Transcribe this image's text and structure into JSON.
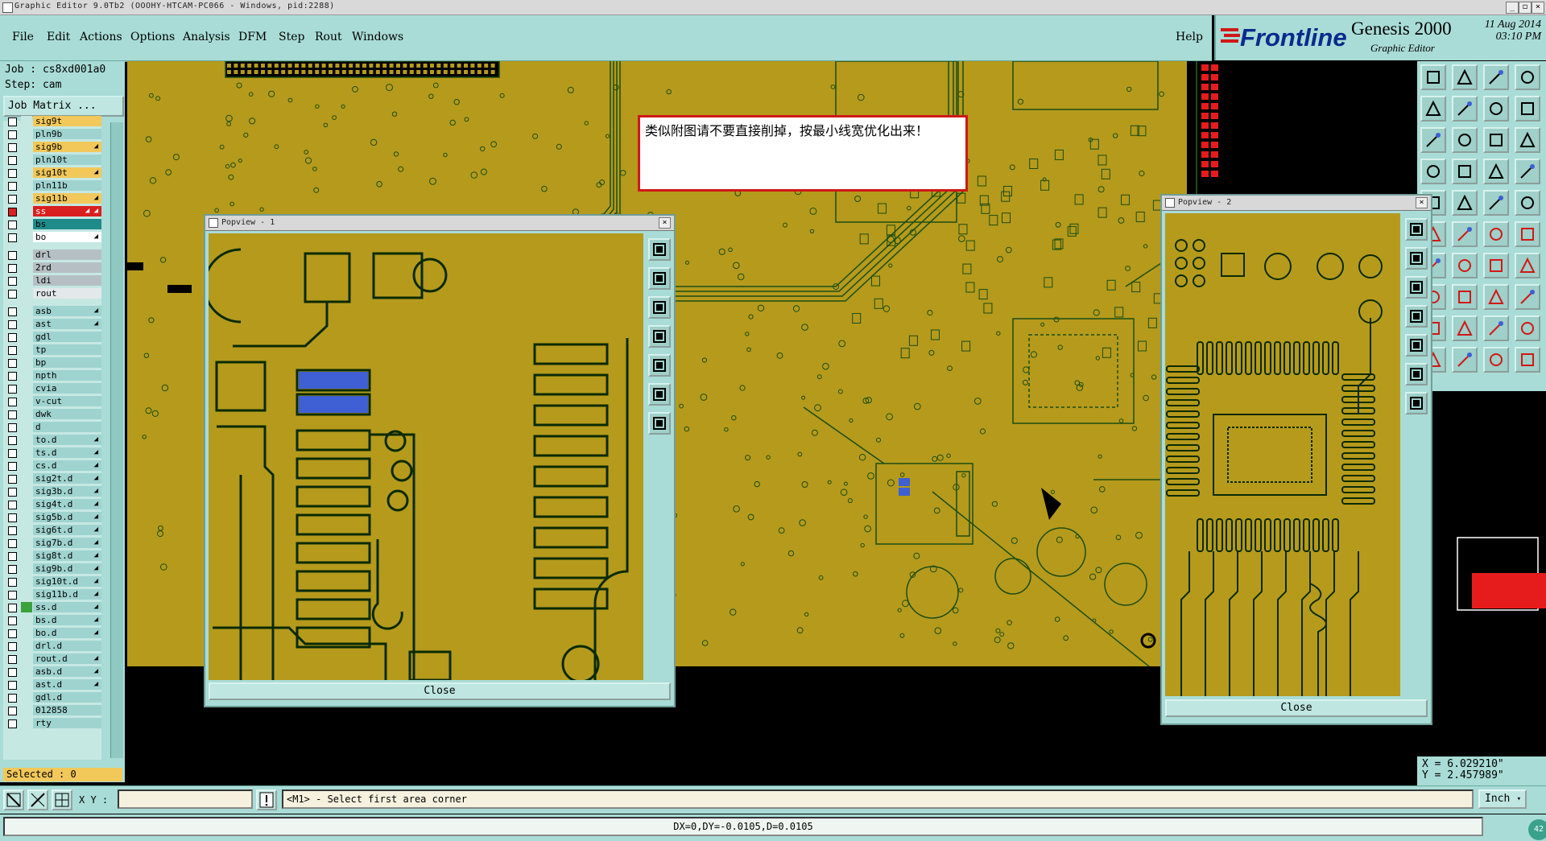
{
  "window": {
    "title": "Graphic Editor 9.0Tb2 (OOOHY-HTCAM-PC066 - Windows, pid:2288)"
  },
  "menu": {
    "items": [
      "File",
      "Edit",
      "Actions",
      "Options",
      "Analysis",
      "DFM",
      "Step",
      "Rout",
      "Windows"
    ],
    "help": "Help"
  },
  "logo": {
    "brand": "Frontline",
    "product": "Genesis 2000",
    "subtitle": "Graphic Editor",
    "date": "11 Aug 2014",
    "time": "03:10 PM"
  },
  "job": {
    "job_line": "Job : cs8xd001a0",
    "step_line": "Step: cam",
    "matrix_button": "Job Matrix ..."
  },
  "layers": [
    {
      "name": "sig9t",
      "color": "#f2c85a",
      "arrow": "",
      "checked": false
    },
    {
      "name": "pln9b",
      "color": "#9fd3cf",
      "arrow": "",
      "checked": false
    },
    {
      "name": "sig9b",
      "color": "#f2c85a",
      "arrow": "◢",
      "checked": false
    },
    {
      "name": "pln10t",
      "color": "#9fd3cf",
      "arrow": "",
      "checked": false
    },
    {
      "name": "sig10t",
      "color": "#f2c85a",
      "arrow": "◢",
      "checked": false
    },
    {
      "name": "pln11b",
      "color": "#9fd3cf",
      "arrow": "",
      "checked": false
    },
    {
      "name": "sig11b",
      "color": "#f2c85a",
      "arrow": "◢",
      "checked": false
    },
    {
      "name": "ss",
      "color": "#d92020",
      "arrow": "◢ ◢",
      "checked": true
    },
    {
      "name": "bs",
      "color": "#1f8a8a",
      "arrow": "",
      "checked": false
    },
    {
      "name": "bo",
      "color": "#ffffff",
      "arrow": "◢",
      "checked": false
    },
    {
      "name": "drl",
      "color": "#b6c0c4",
      "arrow": "",
      "checked": false
    },
    {
      "name": "2rd",
      "color": "#b6c0c4",
      "arrow": "",
      "checked": false
    },
    {
      "name": "ldi",
      "color": "#b6c0c4",
      "arrow": "",
      "checked": false
    },
    {
      "name": "rout",
      "color": "#e3e8ea",
      "arrow": "",
      "checked": false
    },
    {
      "name": "asb",
      "color": "#9fd3cf",
      "arrow": "◢",
      "checked": false
    },
    {
      "name": "ast",
      "color": "#9fd3cf",
      "arrow": "◢",
      "checked": false
    },
    {
      "name": "gdl",
      "color": "#9fd3cf",
      "arrow": "",
      "checked": false
    },
    {
      "name": "tp",
      "color": "#9fd3cf",
      "arrow": "",
      "checked": false
    },
    {
      "name": "bp",
      "color": "#9fd3cf",
      "arrow": "",
      "checked": false
    },
    {
      "name": "npth",
      "color": "#9fd3cf",
      "arrow": "",
      "checked": false
    },
    {
      "name": "cvia",
      "color": "#9fd3cf",
      "arrow": "",
      "checked": false
    },
    {
      "name": "v-cut",
      "color": "#9fd3cf",
      "arrow": "",
      "checked": false
    },
    {
      "name": "dwk",
      "color": "#9fd3cf",
      "arrow": "",
      "checked": false
    },
    {
      "name": "d",
      "color": "#9fd3cf",
      "arrow": "",
      "checked": false
    },
    {
      "name": "to.d",
      "color": "#9fd3cf",
      "arrow": "◢",
      "checked": false
    },
    {
      "name": "ts.d",
      "color": "#9fd3cf",
      "arrow": "◢",
      "checked": false
    },
    {
      "name": "cs.d",
      "color": "#9fd3cf",
      "arrow": "◢",
      "checked": false
    },
    {
      "name": "sig2t.d",
      "color": "#9fd3cf",
      "arrow": "◢",
      "checked": false
    },
    {
      "name": "sig3b.d",
      "color": "#9fd3cf",
      "arrow": "◢",
      "checked": false
    },
    {
      "name": "sig4t.d",
      "color": "#9fd3cf",
      "arrow": "◢",
      "checked": false
    },
    {
      "name": "sig5b.d",
      "color": "#9fd3cf",
      "arrow": "◢",
      "checked": false
    },
    {
      "name": "sig6t.d",
      "color": "#9fd3cf",
      "arrow": "◢",
      "checked": false
    },
    {
      "name": "sig7b.d",
      "color": "#9fd3cf",
      "arrow": "◢",
      "checked": false
    },
    {
      "name": "sig8t.d",
      "color": "#9fd3cf",
      "arrow": "◢",
      "checked": false
    },
    {
      "name": "sig9b.d",
      "color": "#9fd3cf",
      "arrow": "◢",
      "checked": false
    },
    {
      "name": "sig10t.d",
      "color": "#9fd3cf",
      "arrow": "◢",
      "checked": false
    },
    {
      "name": "sig11b.d",
      "color": "#9fd3cf",
      "arrow": "◢",
      "checked": false
    },
    {
      "name": "ss.d",
      "color": "#9fd3cf",
      "arrow": "◢",
      "checked": false
    },
    {
      "name": "bs.d",
      "color": "#9fd3cf",
      "arrow": "◢",
      "checked": false
    },
    {
      "name": "bo.d",
      "color": "#9fd3cf",
      "arrow": "◢",
      "checked": false
    },
    {
      "name": "drl.d",
      "color": "#9fd3cf",
      "arrow": "",
      "checked": false
    },
    {
      "name": "rout.d",
      "color": "#9fd3cf",
      "arrow": "◢",
      "checked": false
    },
    {
      "name": "asb.d",
      "color": "#9fd3cf",
      "arrow": "◢",
      "checked": false
    },
    {
      "name": "ast.d",
      "color": "#9fd3cf",
      "arrow": "◢",
      "checked": false
    },
    {
      "name": "gdl.d",
      "color": "#9fd3cf",
      "arrow": "",
      "checked": false
    },
    {
      "name": "012858",
      "color": "#9fd3cf",
      "arrow": "",
      "checked": false
    },
    {
      "name": "rty",
      "color": "#9fd3cf",
      "arrow": "",
      "checked": false
    }
  ],
  "selected": "Selected : 0",
  "note": "类似附图请不要直接削掉，按最小线宽优化出来！",
  "popview1": {
    "title": "Popview - 1",
    "close": "Close"
  },
  "popview2": {
    "title": "Popview - 2",
    "close": "Close"
  },
  "coords": {
    "x": "X = 6.029210\"",
    "y": "Y = 2.457989\""
  },
  "status": {
    "xy_label": "X Y :",
    "xy_value": "",
    "message": "<M1> - Select first area corner",
    "unit": "Inch",
    "measure": "DX=0,DY=-0.0105,D=0.0105",
    "badge": "42"
  },
  "colors": {
    "board": "#b59a1c",
    "panel": "#a9dcd6",
    "highlight": "#3f5fd4",
    "accent": "#d01818"
  }
}
